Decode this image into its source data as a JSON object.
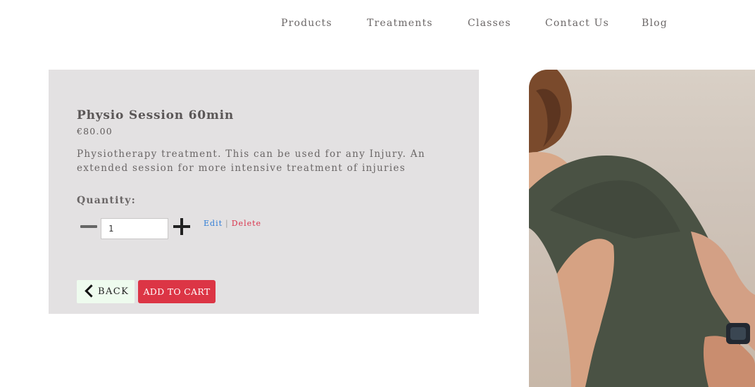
{
  "nav": {
    "items": [
      "Products",
      "Treatments",
      "Classes",
      "Contact Us",
      "Blog"
    ]
  },
  "product": {
    "title": "Physio Session 60min",
    "price": "€80.00",
    "description": "Physiotherapy treatment. This can be used for any Injury. An extended session for more intensive treatment of injuries"
  },
  "quantity": {
    "label": "Quantity:",
    "value": "1"
  },
  "admin": {
    "edit_label": "Edit",
    "separator": "|",
    "delete_label": "Delete"
  },
  "buttons": {
    "back_label": "BACK",
    "add_to_cart_label": "ADD TO CART"
  },
  "colors": {
    "panel_bg": "#e3e1e2",
    "add_to_cart": "#dc3545",
    "back_button_bg": "#eefbee",
    "edit_link": "#2e7cd6",
    "delete_link": "#d9324b"
  },
  "icons": {
    "decrement": "minus-icon",
    "increment": "plus-icon",
    "back": "chevron-left-icon"
  }
}
